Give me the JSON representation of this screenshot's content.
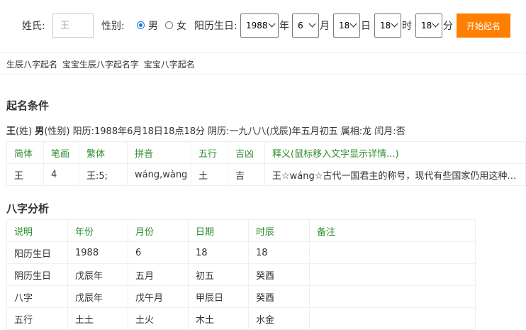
{
  "form": {
    "surname_label": "姓氏:",
    "surname_placeholder": "王",
    "gender_label": "性别:",
    "gender_male": "男",
    "gender_female": "女",
    "birth_label": "阳历生日:",
    "year": "1988",
    "year_unit": "年",
    "month": "6",
    "month_unit": "月",
    "day": "18",
    "day_unit": "日",
    "hour": "18",
    "hour_unit": "时",
    "minute": "18",
    "minute_unit": "分",
    "submit_label": "开始起名"
  },
  "links": [
    "生辰八字起名",
    "宝宝生辰八字起名字",
    "宝宝八字起名"
  ],
  "conditions": {
    "heading": "起名条件",
    "surname": "王",
    "surname_tag": "(姓)",
    "gender": "男",
    "gender_tag": "(性别)",
    "details": "阳历:1988年6月18日18点18分 阴历:一九八八(戊辰)年五月初五 属相:龙 闰月:否"
  },
  "char_table": {
    "headers": [
      "简体",
      "笔画",
      "繁体",
      "拼音",
      "五行",
      "吉凶",
      "释义(鼠标移入文字显示详情...)"
    ],
    "rows": [
      [
        "王",
        "4",
        "王:5;",
        "wáng,wàng",
        "土",
        "吉",
        "王☆wáng☆古代一国君主的称号，现代有些国家仍用这种称号"
      ]
    ]
  },
  "bazi": {
    "heading": "八字分析",
    "headers": [
      "说明",
      "年份",
      "月份",
      "日期",
      "时辰",
      "备注"
    ],
    "rows": [
      [
        "阳历生日",
        "1988",
        "6",
        "18",
        "18",
        ""
      ],
      [
        "阴历生日",
        "戊辰年",
        "五月",
        "初五",
        "癸酉",
        ""
      ],
      [
        "八字",
        "戊辰年",
        "戊午月",
        "甲辰日",
        "癸酉",
        ""
      ],
      [
        "五行",
        "土土",
        "土火",
        "木土",
        "水金",
        ""
      ]
    ]
  },
  "colors": {
    "accent": "#ff7f00",
    "header_green": "#2e8b2e",
    "radio_blue": "#1a73e8"
  }
}
